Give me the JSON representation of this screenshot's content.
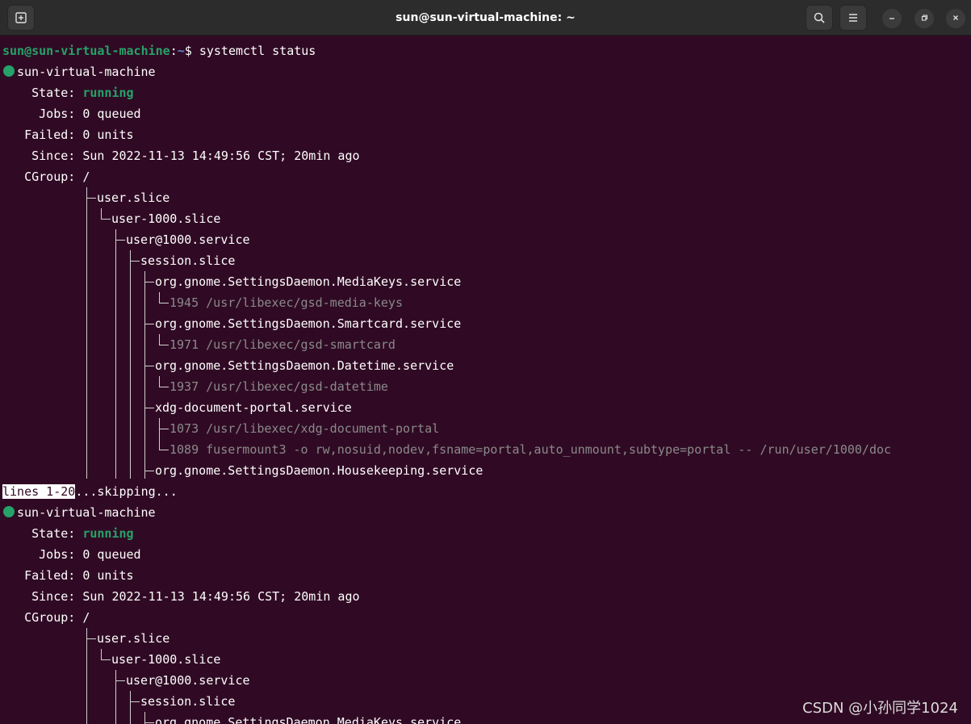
{
  "window": {
    "title": "sun@sun-virtual-machine: ~"
  },
  "icons": {
    "new_tab": "new-tab-icon",
    "search": "search-icon",
    "menu": "hamburger-menu-icon",
    "minimize": "minimize-icon",
    "maximize": "maximize-icon",
    "close": "close-icon"
  },
  "colors": {
    "terminal_bg": "#300a24",
    "titlebar_bg": "#2c2c2c",
    "green": "#26a269",
    "gray_text": "#8a8a8a"
  },
  "prompt": {
    "user_host": "sun@sun-virtual-machine",
    "separator": ":",
    "path": "~",
    "symbol": "$ ",
    "command": "systemctl status"
  },
  "status_block": {
    "host": "sun-virtual-machine",
    "state_label": "    State: ",
    "state_value": "running",
    "jobs": "     Jobs: 0 queued",
    "failed": "   Failed: 0 units",
    "since": "    Since: Sun 2022-11-13 14:49:56 CST; 20min ago",
    "cgroup": "   CGroup: /"
  },
  "tree": {
    "user_slice": "user.slice",
    "user_1000_slice": "user-1000.slice",
    "user_service": "user@1000.service",
    "session_slice": "session.slice",
    "mediakeys_service": "org.gnome.SettingsDaemon.MediaKeys.service",
    "mediakeys_proc": "1945 /usr/libexec/gsd-media-keys",
    "smartcard_service": "org.gnome.SettingsDaemon.Smartcard.service",
    "smartcard_proc": "1971 /usr/libexec/gsd-smartcard",
    "datetime_service": "org.gnome.SettingsDaemon.Datetime.service",
    "datetime_proc": "1937 /usr/libexec/gsd-datetime",
    "xdg_service": "xdg-document-portal.service",
    "xdg_proc1": "1073 /usr/libexec/xdg-document-portal",
    "xdg_proc2": "1089 fusermount3 -o rw,nosuid,nodev,fsname=portal,auto_unmount,subtype=portal -- /run/user/1000/doc",
    "housekeeping_service": "org.gnome.SettingsDaemon.Housekeeping.service"
  },
  "pager": {
    "lines_label": "lines 1-20",
    "skipping": "...skipping..."
  },
  "watermark": "CSDN @小孙同学1024"
}
